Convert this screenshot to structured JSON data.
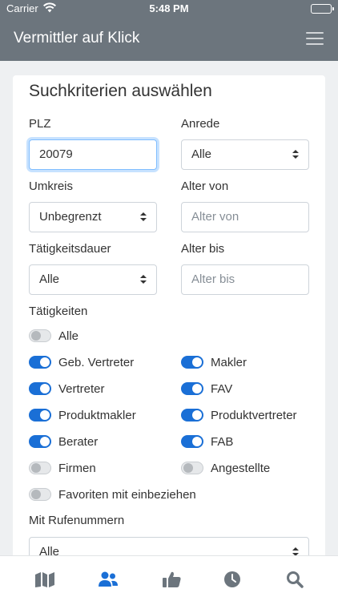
{
  "status_bar": {
    "carrier": "Carrier",
    "time": "5:48 PM"
  },
  "navbar": {
    "title": "Vermittler auf Klick"
  },
  "form": {
    "title": "Suchkriterien auswählen",
    "plz": {
      "label": "PLZ",
      "value": "20079"
    },
    "anrede": {
      "label": "Anrede",
      "value": "Alle"
    },
    "umkreis": {
      "label": "Umkreis",
      "value": "Unbegrenzt"
    },
    "alter_von": {
      "label": "Alter von",
      "placeholder": "Alter von"
    },
    "taetigkeitsdauer": {
      "label": "Tätigkeitsdauer",
      "value": "Alle"
    },
    "alter_bis": {
      "label": "Alter bis",
      "placeholder": "Alter bis"
    },
    "taetigkeiten": {
      "label": "Tätigkeiten",
      "items": [
        {
          "label": "Alle",
          "on": false
        },
        {
          "label": "Geb. Vertreter",
          "on": true
        },
        {
          "label": "Makler",
          "on": true
        },
        {
          "label": "Vertreter",
          "on": true
        },
        {
          "label": "FAV",
          "on": true
        },
        {
          "label": "Produktmakler",
          "on": true
        },
        {
          "label": "Produktvertreter",
          "on": true
        },
        {
          "label": "Berater",
          "on": true
        },
        {
          "label": "FAB",
          "on": true
        },
        {
          "label": "Firmen",
          "on": false
        },
        {
          "label": "Angestellte",
          "on": false
        }
      ]
    },
    "favoriten": {
      "label": "Favoriten mit einbeziehen",
      "on": false
    },
    "rufnummern": {
      "label": "Mit Rufenummern",
      "value": "Alle"
    }
  },
  "tabbar": {
    "tabs": [
      {
        "icon": "map-icon",
        "active": false
      },
      {
        "icon": "users-icon",
        "active": true
      },
      {
        "icon": "thumbs-up-icon",
        "active": false
      },
      {
        "icon": "clock-icon",
        "active": false
      },
      {
        "icon": "search-icon",
        "active": false
      }
    ]
  },
  "colors": {
    "navbar": "#6c757d",
    "accent": "#1a6fd6",
    "tab_inactive": "#6c757d"
  }
}
